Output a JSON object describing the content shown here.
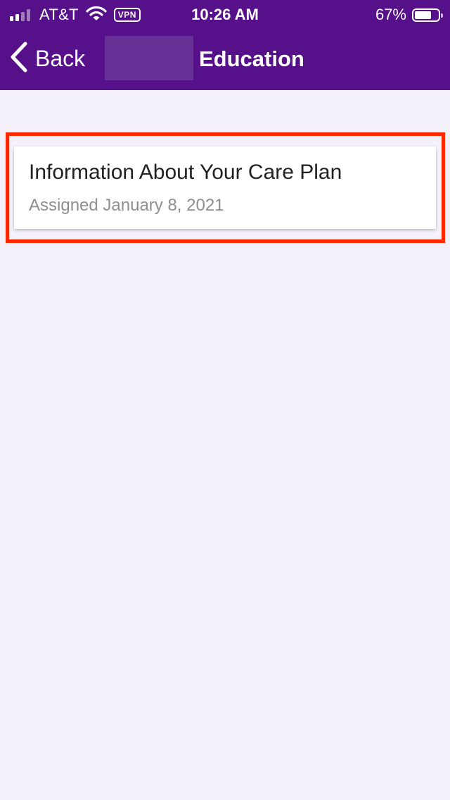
{
  "status_bar": {
    "carrier": "AT&T",
    "vpn_label": "VPN",
    "time": "10:26 AM",
    "battery_percent": "67%",
    "battery_level": 0.67,
    "signal_bars_active": 2,
    "signal_bars_total": 4,
    "icons": [
      "signal-icon",
      "wifi-icon",
      "vpn-badge",
      "battery-icon"
    ]
  },
  "nav": {
    "back_label": "Back",
    "back_icon": "chevron-left-icon",
    "title": "Education"
  },
  "items": [
    {
      "title": "Information About Your Care Plan",
      "subtitle": "Assigned January 8, 2021"
    }
  ],
  "colors": {
    "header_bg": "#56108a",
    "page_bg": "#f4f1fb",
    "card_bg": "#ffffff",
    "highlight_border": "#ff2a00",
    "title_text": "#222222",
    "subtitle_text": "#8e8e8e"
  }
}
